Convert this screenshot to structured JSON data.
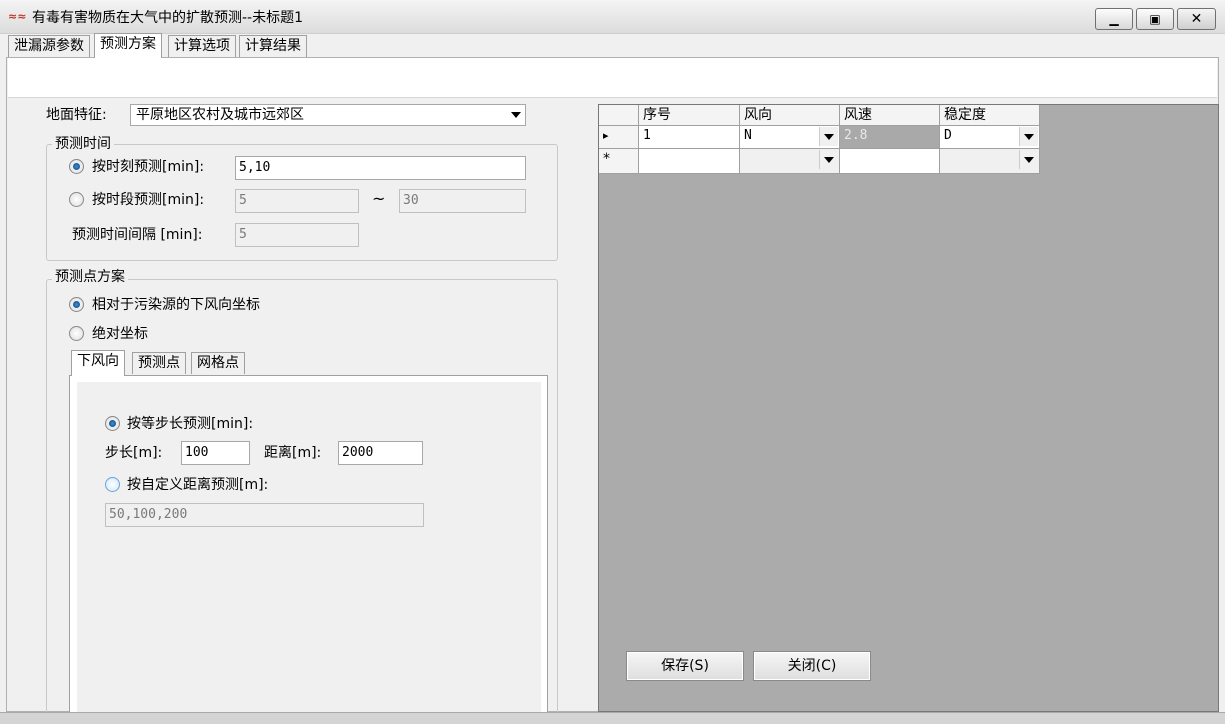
{
  "window": {
    "title": "有毒有害物质在大气中的扩散预测--未标题1",
    "app_icon_text": "≈≈",
    "min_glyph": "▁",
    "max_glyph": "▣",
    "close_glyph": "✕"
  },
  "main_tabs": [
    "泄漏源参数",
    "预测方案",
    "计算选项",
    "计算结果"
  ],
  "ground": {
    "label": "地面特征:",
    "value": "平原地区农村及城市远郊区"
  },
  "time_group": {
    "title": "预测时间",
    "by_moment_label": "按时刻预测[min]:",
    "by_moment_value": "5,10",
    "by_period_label": "按时段预测[min]:",
    "period_start": "5",
    "tilde": "~",
    "period_end": "30",
    "interval_label": "预测时间间隔 [min]:",
    "interval_value": "5"
  },
  "point_group": {
    "title": "预测点方案",
    "relative_label": "相对于污染源的下风向坐标",
    "absolute_label": "绝对坐标"
  },
  "sub_tabs": [
    "下风向",
    "预测点",
    "网格点"
  ],
  "downwind": {
    "equal_step_label": "按等步长预测[min]:",
    "step_label": "步长[m]:",
    "step_value": "100",
    "distance_label": "距离[m]:",
    "distance_value": "2000",
    "custom_label": "按自定义距离预测[m]:",
    "custom_value": "50,100,200"
  },
  "grid": {
    "headers": [
      "序号",
      "风向",
      "风速",
      "稳定度"
    ],
    "row1": {
      "indicator": "▸",
      "seq": "1",
      "direction": "N",
      "speed": "2.8",
      "stability": "D"
    },
    "new_row_indicator": "*"
  },
  "buttons": {
    "save": "保存(S)",
    "close": "关闭(C)"
  }
}
